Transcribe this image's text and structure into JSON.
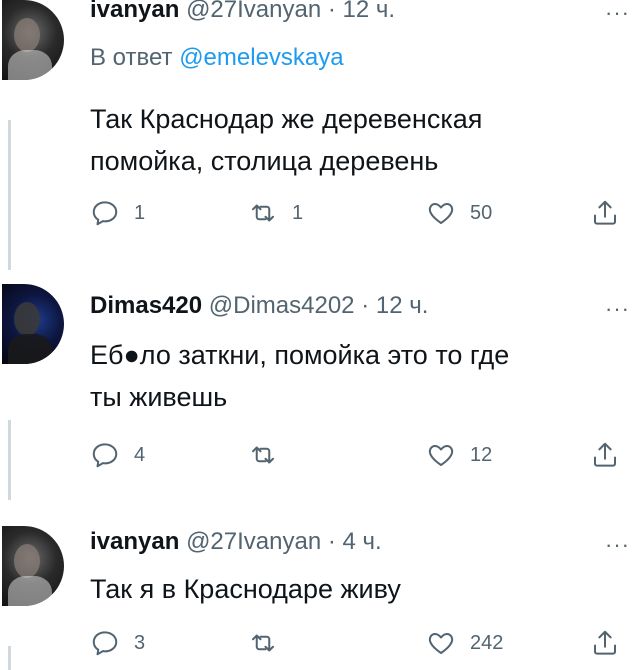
{
  "tweets": [
    {
      "name": "ivanyan",
      "handle": "@27Ivanyan",
      "sep": "·",
      "time": "12 ч.",
      "reply_prefix": "В ответ",
      "reply_mention": "@emelevskaya",
      "text_lines": [
        "Так Краснодар же деревенская",
        "помойка, столица деревень"
      ],
      "replies": "1",
      "retweets": "1",
      "likes": "50"
    },
    {
      "name": "Dimas420",
      "handle": "@Dimas4202",
      "sep": "·",
      "time": "12 ч.",
      "text_lines": [
        "Еб●ло заткни, помойка это то где",
        "ты живешь"
      ],
      "replies": "4",
      "retweets": "",
      "likes": "12"
    },
    {
      "name": "ivanyan",
      "handle": "@27Ivanyan",
      "sep": "·",
      "time": "4 ч.",
      "text_lines": [
        "Так я в Краснодаре живу"
      ],
      "replies": "3",
      "retweets": "",
      "likes": "242"
    }
  ],
  "more_icon": "···",
  "icons": {
    "reply": "reply-icon",
    "retweet": "retweet-icon",
    "like": "heart-icon",
    "share": "share-icon",
    "more": "more-icon"
  },
  "colors": {
    "text": "#0f1419",
    "secondary": "#536471",
    "link": "#1d9bf0",
    "thread_line": "#cfd9de"
  }
}
